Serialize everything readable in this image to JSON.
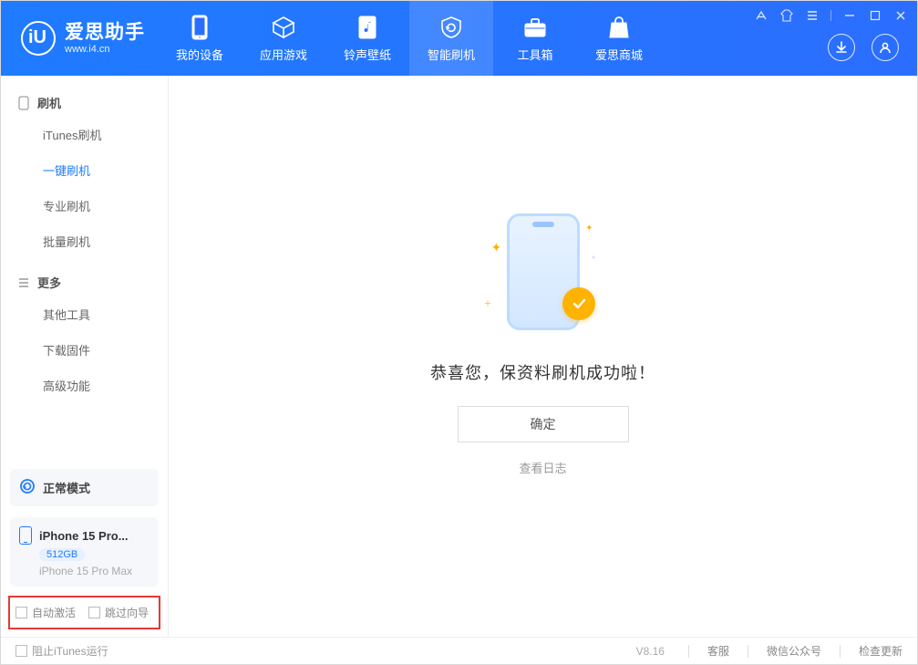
{
  "app": {
    "title": "爱思助手",
    "url": "www.i4.cn"
  },
  "nav": [
    {
      "label": "我的设备"
    },
    {
      "label": "应用游戏"
    },
    {
      "label": "铃声壁纸"
    },
    {
      "label": "智能刷机"
    },
    {
      "label": "工具箱"
    },
    {
      "label": "爱思商城"
    }
  ],
  "sidebar": {
    "group1": {
      "title": "刷机",
      "items": [
        "iTunes刷机",
        "一键刷机",
        "专业刷机",
        "批量刷机"
      ]
    },
    "group2": {
      "title": "更多",
      "items": [
        "其他工具",
        "下载固件",
        "高级功能"
      ]
    }
  },
  "status": {
    "mode": "正常模式"
  },
  "device": {
    "name": "iPhone 15 Pro...",
    "storage": "512GB",
    "full": "iPhone 15 Pro Max"
  },
  "checks": {
    "auto_activate": "自动激活",
    "skip_guide": "跳过向导"
  },
  "main": {
    "message": "恭喜您，保资料刷机成功啦！",
    "ok": "确定",
    "view_log": "查看日志"
  },
  "footer": {
    "block_itunes": "阻止iTunes运行",
    "version": "V8.16",
    "support": "客服",
    "wechat": "微信公众号",
    "update": "检查更新"
  }
}
